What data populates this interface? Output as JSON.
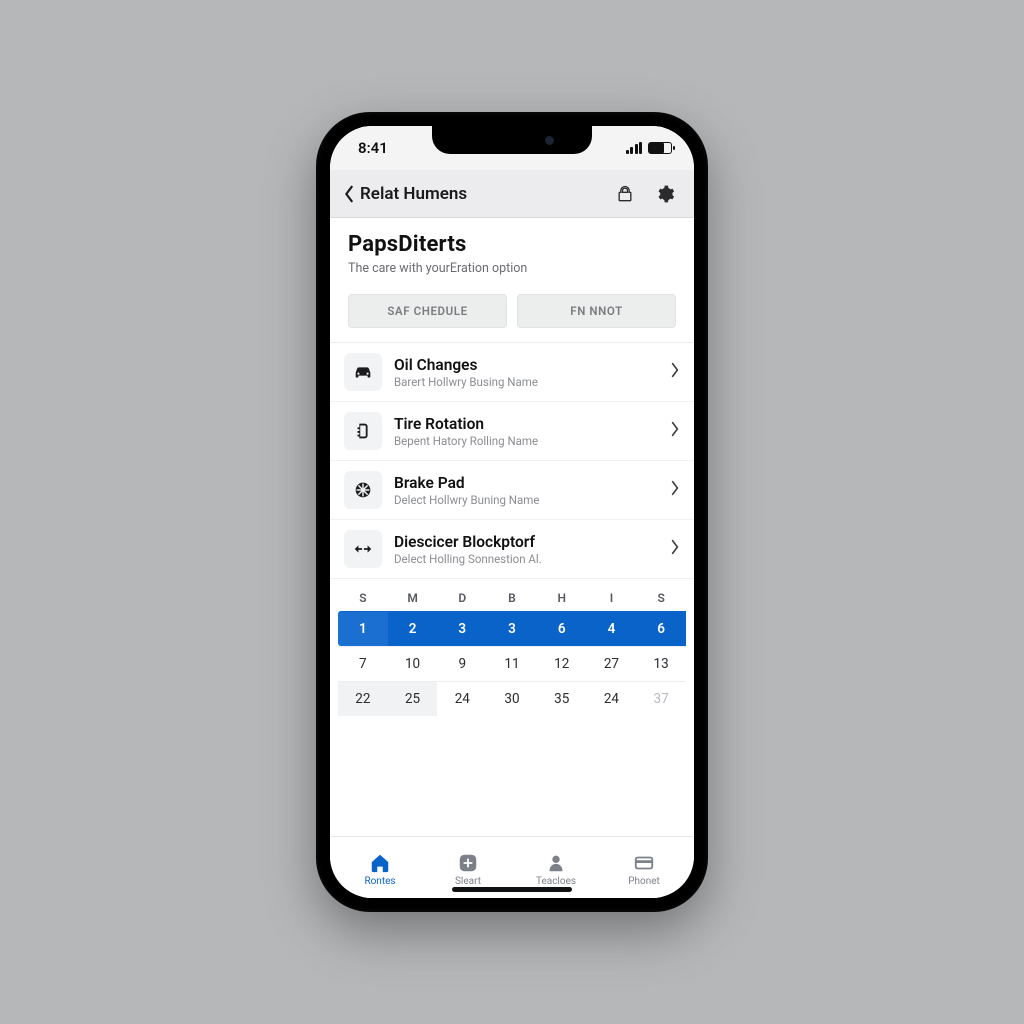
{
  "status": {
    "time": "8:41"
  },
  "nav": {
    "back_label": "Relat Humens"
  },
  "hero": {
    "title": "PapsDiterts",
    "subtitle": "The care with yourEration option"
  },
  "segmented": {
    "left": "SAF CHEDULE",
    "right": "FN NNOT"
  },
  "list": [
    {
      "icon": "car-icon",
      "title": "Oil Changes",
      "sub": "Barert Hollwry Busing Name"
    },
    {
      "icon": "tire-icon",
      "title": "Tire Rotation",
      "sub": "Bepent Hatory Rolling Name"
    },
    {
      "icon": "brake-icon",
      "title": "Brake Pad",
      "sub": "Delect Hollwry Buning Name"
    },
    {
      "icon": "arrows-icon",
      "title": "Diescicer Blockptorf",
      "sub": "Delect Holling Sonnestion Al."
    }
  ],
  "calendar": {
    "days": [
      "S",
      "M",
      "D",
      "B",
      "H",
      "I",
      "S"
    ],
    "rows": [
      [
        "1",
        "2",
        "3",
        "3",
        "6",
        "4",
        "6"
      ],
      [
        "7",
        "10",
        "9",
        "11",
        "12",
        "27",
        "13"
      ],
      [
        "22",
        "25",
        "24",
        "30",
        "35",
        "24",
        "37"
      ]
    ],
    "selected_row": 0
  },
  "tabs": [
    {
      "icon": "home-icon",
      "label": "Rontes",
      "active": true
    },
    {
      "icon": "plus-icon",
      "label": "Sleart",
      "active": false
    },
    {
      "icon": "person-icon",
      "label": "Teacloes",
      "active": false
    },
    {
      "icon": "card-icon",
      "label": "Phonet",
      "active": false
    }
  ]
}
